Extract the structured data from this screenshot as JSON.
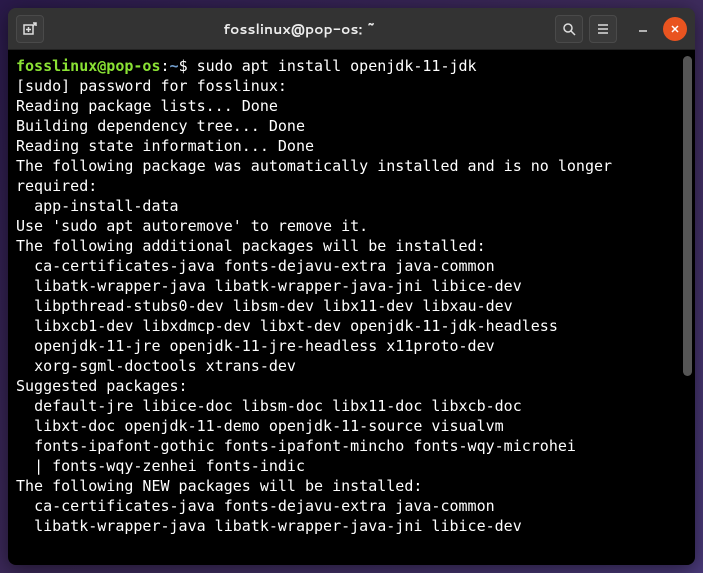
{
  "window": {
    "title": "fosslinux@pop-os: ~"
  },
  "prompt": {
    "user_host": "fosslinux@pop-os",
    "separator1": ":",
    "path": "~",
    "separator2": "$ ",
    "command": "sudo apt install openjdk-11-jdk"
  },
  "output": {
    "lines": [
      "[sudo] password for fosslinux: ",
      "Reading package lists... Done",
      "Building dependency tree... Done",
      "Reading state information... Done",
      "The following package was automatically installed and is no longer required:",
      "  app-install-data",
      "Use 'sudo apt autoremove' to remove it.",
      "The following additional packages will be installed:",
      "  ca-certificates-java fonts-dejavu-extra java-common",
      "  libatk-wrapper-java libatk-wrapper-java-jni libice-dev",
      "  libpthread-stubs0-dev libsm-dev libx11-dev libxau-dev",
      "  libxcb1-dev libxdmcp-dev libxt-dev openjdk-11-jdk-headless",
      "  openjdk-11-jre openjdk-11-jre-headless x11proto-dev",
      "  xorg-sgml-doctools xtrans-dev",
      "Suggested packages:",
      "  default-jre libice-doc libsm-doc libx11-doc libxcb-doc",
      "  libxt-doc openjdk-11-demo openjdk-11-source visualvm",
      "  fonts-ipafont-gothic fonts-ipafont-mincho fonts-wqy-microhei",
      "  | fonts-wqy-zenhei fonts-indic",
      "The following NEW packages will be installed:",
      "  ca-certificates-java fonts-dejavu-extra java-common",
      "  libatk-wrapper-java libatk-wrapper-java-jni libice-dev"
    ]
  }
}
